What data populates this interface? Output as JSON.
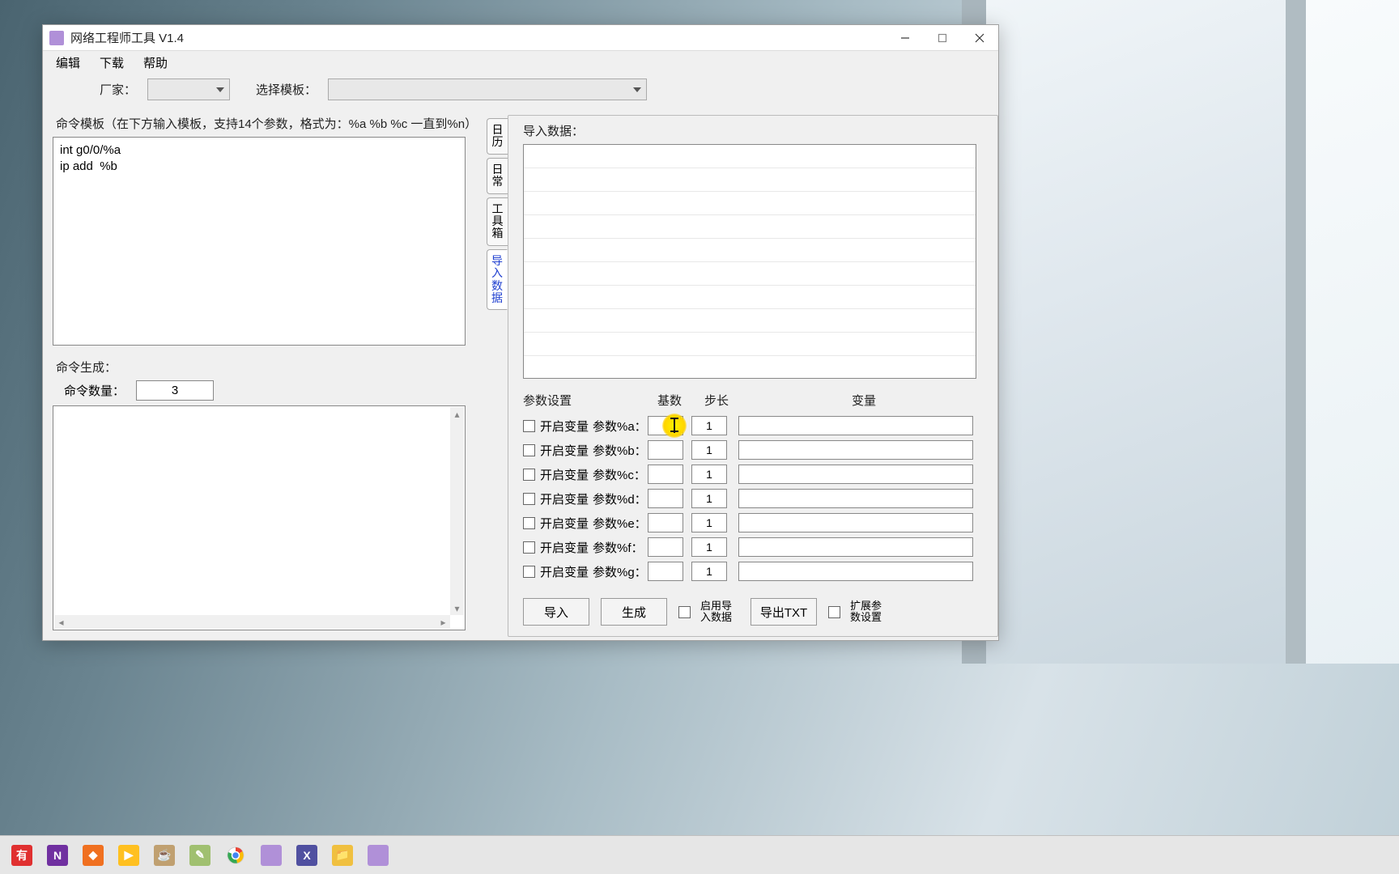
{
  "window": {
    "title": "网络工程师工具 V1.4"
  },
  "menu": {
    "edit": "编辑",
    "download": "下载",
    "help": "帮助"
  },
  "toolbar": {
    "vendor_label": "厂家：",
    "vendor_value": "",
    "template_select_label": "选择模板：",
    "template_select_value": ""
  },
  "left": {
    "template_caption": "命令模板（在下方输入模板，支持14个参数，格式为：%a %b %c 一直到%n）",
    "template_text": "int g0/0/%a\nip add  %b",
    "generate_caption": "命令生成：",
    "qty_label": "命令数量：",
    "qty_value": "3",
    "output_text": ""
  },
  "side_tabs": {
    "t1": "日历",
    "t2": "日常",
    "t3": "工具箱",
    "t4": "导入数据"
  },
  "right": {
    "import_label": "导入数据：",
    "param_headers": {
      "set": "参数设置",
      "base": "基数",
      "step": "步长",
      "var": "变量"
    },
    "chk_label": "开启变量",
    "params": [
      {
        "label": "参数%a：",
        "base": "",
        "step": "1",
        "var": ""
      },
      {
        "label": "参数%b：",
        "base": "",
        "step": "1",
        "var": ""
      },
      {
        "label": "参数%c：",
        "base": "",
        "step": "1",
        "var": ""
      },
      {
        "label": "参数%d：",
        "base": "",
        "step": "1",
        "var": ""
      },
      {
        "label": "参数%e：",
        "base": "",
        "step": "1",
        "var": ""
      },
      {
        "label": "参数%f：",
        "base": "",
        "step": "1",
        "var": ""
      },
      {
        "label": "参数%g：",
        "base": "",
        "step": "1",
        "var": ""
      }
    ],
    "buttons": {
      "import": "导入",
      "generate": "生成",
      "enable_import": "启用导入数据",
      "export_txt": "导出TXT",
      "extend_params": "扩展参数设置"
    }
  },
  "taskbar": {
    "items": [
      {
        "color": "#e03030",
        "txt": "有"
      },
      {
        "color": "#7030a0",
        "txt": "N"
      },
      {
        "color": "#f07020",
        "txt": "◆"
      },
      {
        "color": "#ffc020",
        "txt": "▶"
      },
      {
        "color": "#c0a070",
        "txt": "☕"
      },
      {
        "color": "#a0c070",
        "txt": "✎"
      },
      {
        "color": "#ffffff",
        "txt": "",
        "chrome": true
      },
      {
        "color": "#b090d8",
        "txt": ""
      },
      {
        "color": "#5050a0",
        "txt": "X"
      },
      {
        "color": "#f0c040",
        "txt": "📁"
      },
      {
        "color": "#b090d8",
        "txt": ""
      }
    ]
  }
}
